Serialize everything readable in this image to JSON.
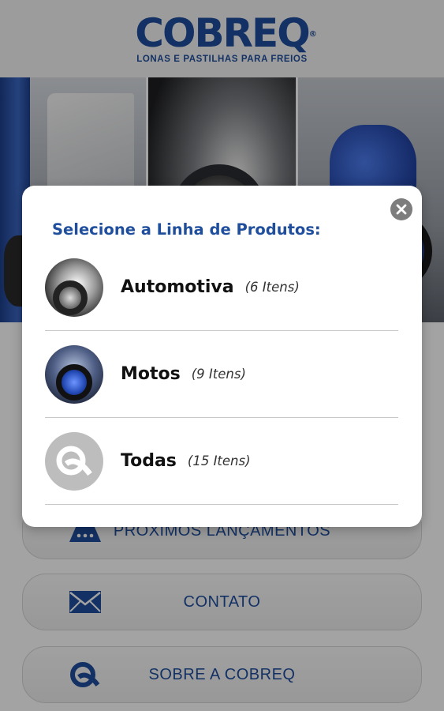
{
  "header": {
    "brand": "COBREQ",
    "registered_mark": "®",
    "tagline": "LONAS E PASTILHAS PARA FREIOS",
    "brand_color": "#1f4e9d"
  },
  "banner": {
    "panels": [
      "truck",
      "car",
      "motorcycle"
    ]
  },
  "menu": {
    "items": [
      {
        "label": "PRÓXIMOS LANÇAMENTOS",
        "icon": "truck-dots-icon"
      },
      {
        "label": "CONTATO",
        "icon": "envelope-icon"
      },
      {
        "label": "SOBRE A COBREQ",
        "icon": "cobreq-logo-icon"
      }
    ]
  },
  "modal": {
    "title": "Selecione a Linha de Produtos:",
    "close_icon": "close-icon",
    "options": [
      {
        "name": "Automotiva",
        "count": "(6 Itens)",
        "thumb": "car-wheel-image"
      },
      {
        "name": "Motos",
        "count": "(9 Itens)",
        "thumb": "motorcycle-image"
      },
      {
        "name": "Todas",
        "count": "(15 Itens)",
        "thumb": "cobreq-logo-icon"
      }
    ]
  }
}
